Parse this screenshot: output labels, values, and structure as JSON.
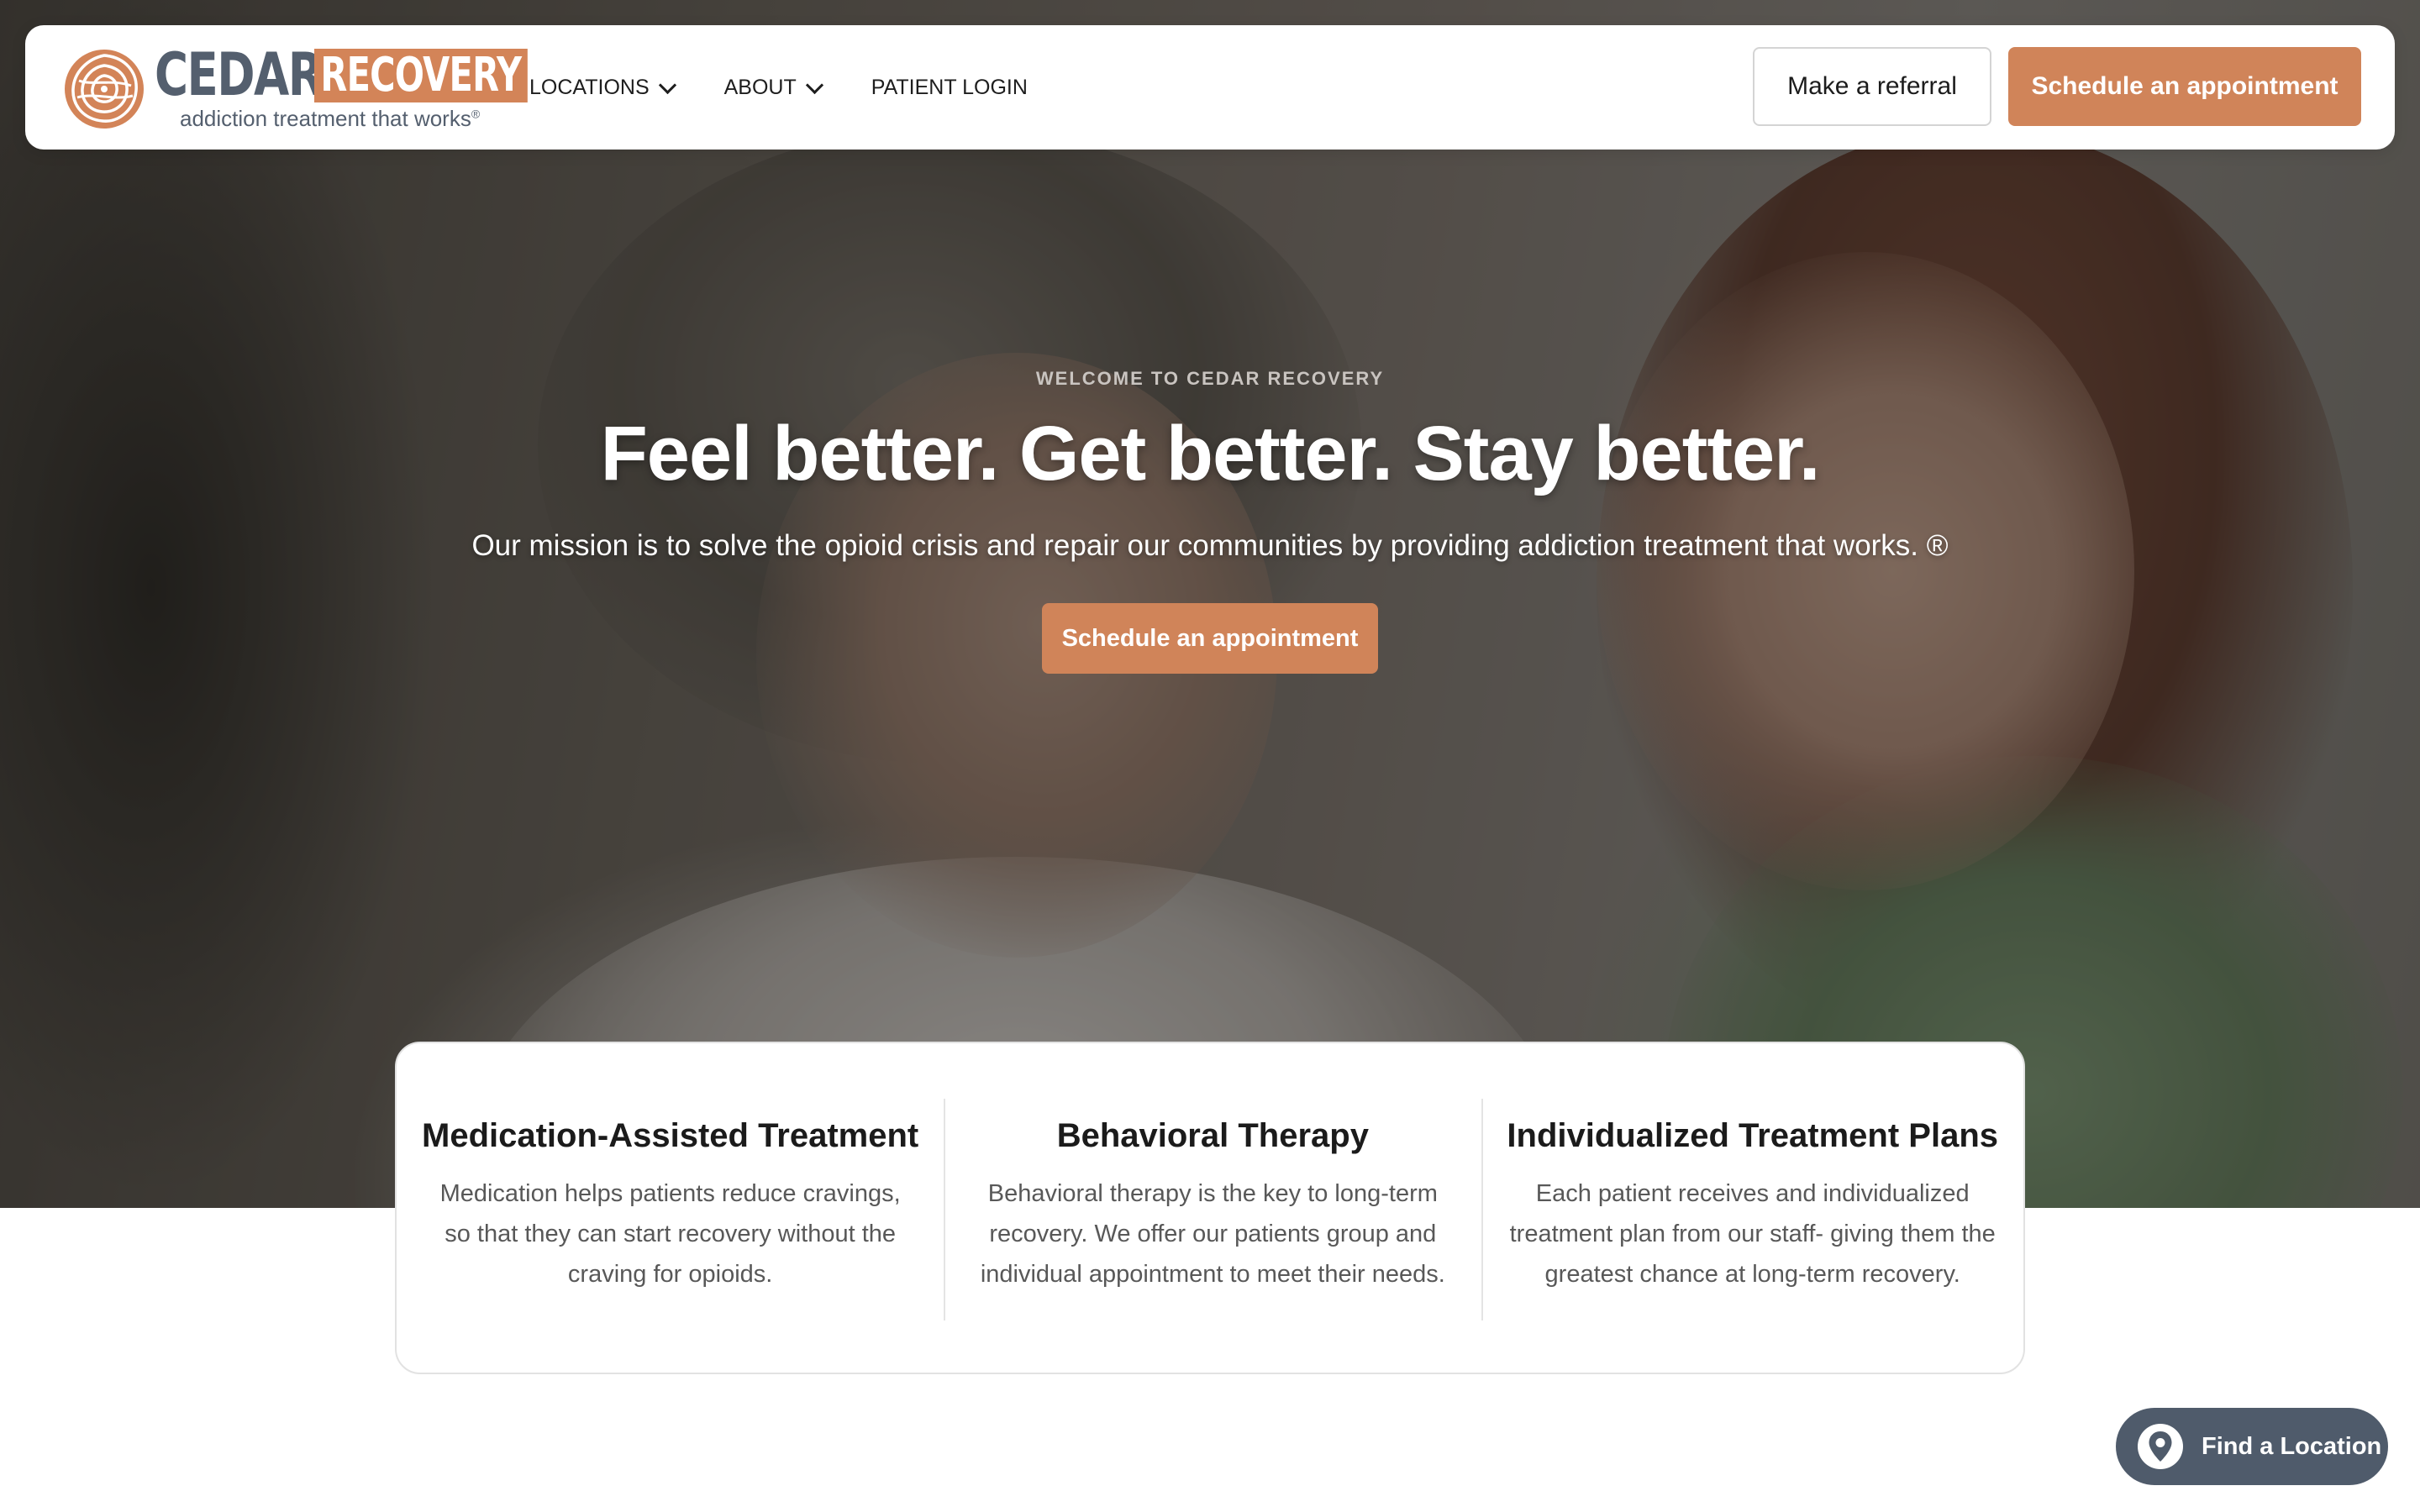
{
  "brand": {
    "name_main": "CEDAR",
    "name_accent": "RECOVERY",
    "tagline": "addiction treatment that works",
    "tagline_mark": "®",
    "colors": {
      "accent": "#d08459",
      "slate": "#545f6e"
    }
  },
  "nav": {
    "items": [
      {
        "label": "LOCATIONS",
        "has_dropdown": true
      },
      {
        "label": "ABOUT",
        "has_dropdown": true
      },
      {
        "label": "PATIENT LOGIN",
        "has_dropdown": false
      }
    ]
  },
  "header_actions": {
    "referral_label": "Make a referral",
    "schedule_label": "Schedule an appointment"
  },
  "hero": {
    "eyebrow": "WELCOME TO CEDAR RECOVERY",
    "headline": "Feel better. Get better. Stay better.",
    "mission": "Our mission is to solve the opioid crisis and repair our communities by providing addiction treatment that works. ®",
    "cta_label": "Schedule an appointment"
  },
  "features": [
    {
      "title": "Medication-Assisted Treatment",
      "description": "Medication helps patients reduce cravings, so that they can start recovery without the craving for opioids."
    },
    {
      "title": "Behavioral Therapy",
      "description": "Behavioral therapy is the key to long-term recovery. We offer our patients group and individual appointment to meet their needs."
    },
    {
      "title": "Individualized Treatment Plans",
      "description": "Each patient receives and individualized treatment plan from our staff- giving them the greatest chance at long-term recovery."
    }
  ],
  "floating": {
    "find_location_label": "Find a Location",
    "icon": "map-pin-icon"
  }
}
